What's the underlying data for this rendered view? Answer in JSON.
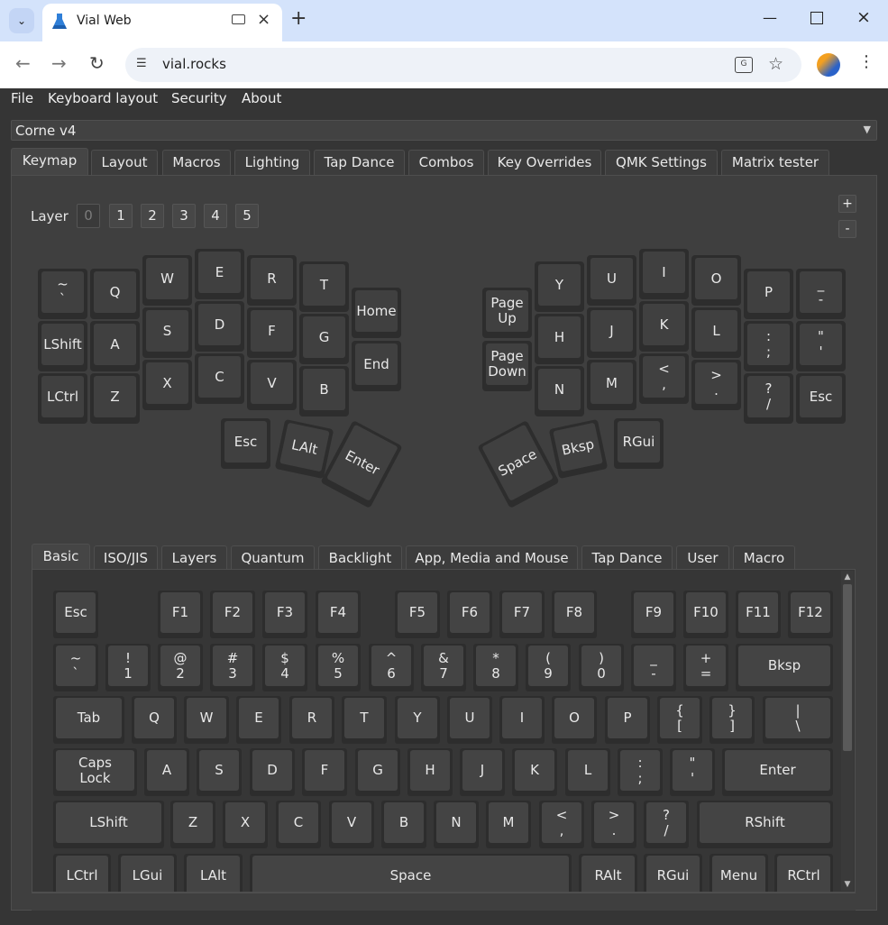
{
  "browser": {
    "tab_title": "Vial Web",
    "url": "vial.rocks",
    "translate_label": "G"
  },
  "menu": [
    "File",
    "Keyboard layout",
    "Security",
    "About"
  ],
  "keyboard_select": "Corne v4",
  "main_tabs": [
    "Keymap",
    "Layout",
    "Macros",
    "Lighting",
    "Tap Dance",
    "Combos",
    "Key Overrides",
    "QMK Settings",
    "Matrix tester"
  ],
  "layer": {
    "label": "Layer",
    "buttons": [
      "0",
      "1",
      "2",
      "3",
      "4",
      "5"
    ],
    "active": "0",
    "plus": "+",
    "minus": "-"
  },
  "keymap_keys": [
    {
      "l": "~\n`"
    },
    {
      "l": "Q"
    },
    {
      "l": "W"
    },
    {
      "l": "E"
    },
    {
      "l": "R"
    },
    {
      "l": "T"
    },
    {
      "l": "Home"
    },
    {
      "l": "LShift"
    },
    {
      "l": "A"
    },
    {
      "l": "S"
    },
    {
      "l": "D"
    },
    {
      "l": "F"
    },
    {
      "l": "G"
    },
    {
      "l": "End"
    },
    {
      "l": "LCtrl"
    },
    {
      "l": "Z"
    },
    {
      "l": "X"
    },
    {
      "l": "C"
    },
    {
      "l": "V"
    },
    {
      "l": "B"
    },
    {
      "l": "Esc"
    },
    {
      "l": "LAlt"
    },
    {
      "l": "Enter"
    },
    {
      "l": "Page\nUp"
    },
    {
      "l": "Y"
    },
    {
      "l": "U"
    },
    {
      "l": "I"
    },
    {
      "l": "O"
    },
    {
      "l": "P"
    },
    {
      "l": "_\n-"
    },
    {
      "l": "Page\nDown"
    },
    {
      "l": "H"
    },
    {
      "l": "J"
    },
    {
      "l": "K"
    },
    {
      "l": "L"
    },
    {
      "l": ":\n;"
    },
    {
      "l": "\"\n'"
    },
    {
      "l": "N"
    },
    {
      "l": "M"
    },
    {
      "l": "<\n,"
    },
    {
      "l": ">\n."
    },
    {
      "l": "?\n/"
    },
    {
      "l": "Esc"
    },
    {
      "l": "Space"
    },
    {
      "l": "Bksp"
    },
    {
      "l": "RGui"
    }
  ],
  "sub_tabs": [
    "Basic",
    "ISO/JIS",
    "Layers",
    "Quantum",
    "Backlight",
    "App, Media and Mouse",
    "Tap Dance",
    "User",
    "Macro"
  ],
  "basic_keys": [
    "Esc",
    "F1",
    "F2",
    "F3",
    "F4",
    "F5",
    "F6",
    "F7",
    "F8",
    "F9",
    "F10",
    "F11",
    "F12",
    "~\n`",
    "!\n1",
    "@\n2",
    "#\n3",
    "$\n4",
    "%\n5",
    "^\n6",
    "&\n7",
    "*\n8",
    "(\n9",
    ")\n0",
    "_\n-",
    "+\n=",
    "Bksp",
    "Tab",
    "Q",
    "W",
    "E",
    "R",
    "T",
    "Y",
    "U",
    "I",
    "O",
    "P",
    "{\n[",
    "}\n]",
    "|\n\\",
    "Caps\nLock",
    "A",
    "S",
    "D",
    "F",
    "G",
    "H",
    "J",
    "K",
    "L",
    ":\n;",
    "\"\n'",
    "Enter",
    "LShift",
    "Z",
    "X",
    "C",
    "V",
    "B",
    "N",
    "M",
    "<\n,",
    ">\n.",
    "?\n/",
    "RShift",
    "LCtrl",
    "LGui",
    "LAlt",
    "Space",
    "RAlt",
    "RGui",
    "Menu",
    "RCtrl"
  ]
}
